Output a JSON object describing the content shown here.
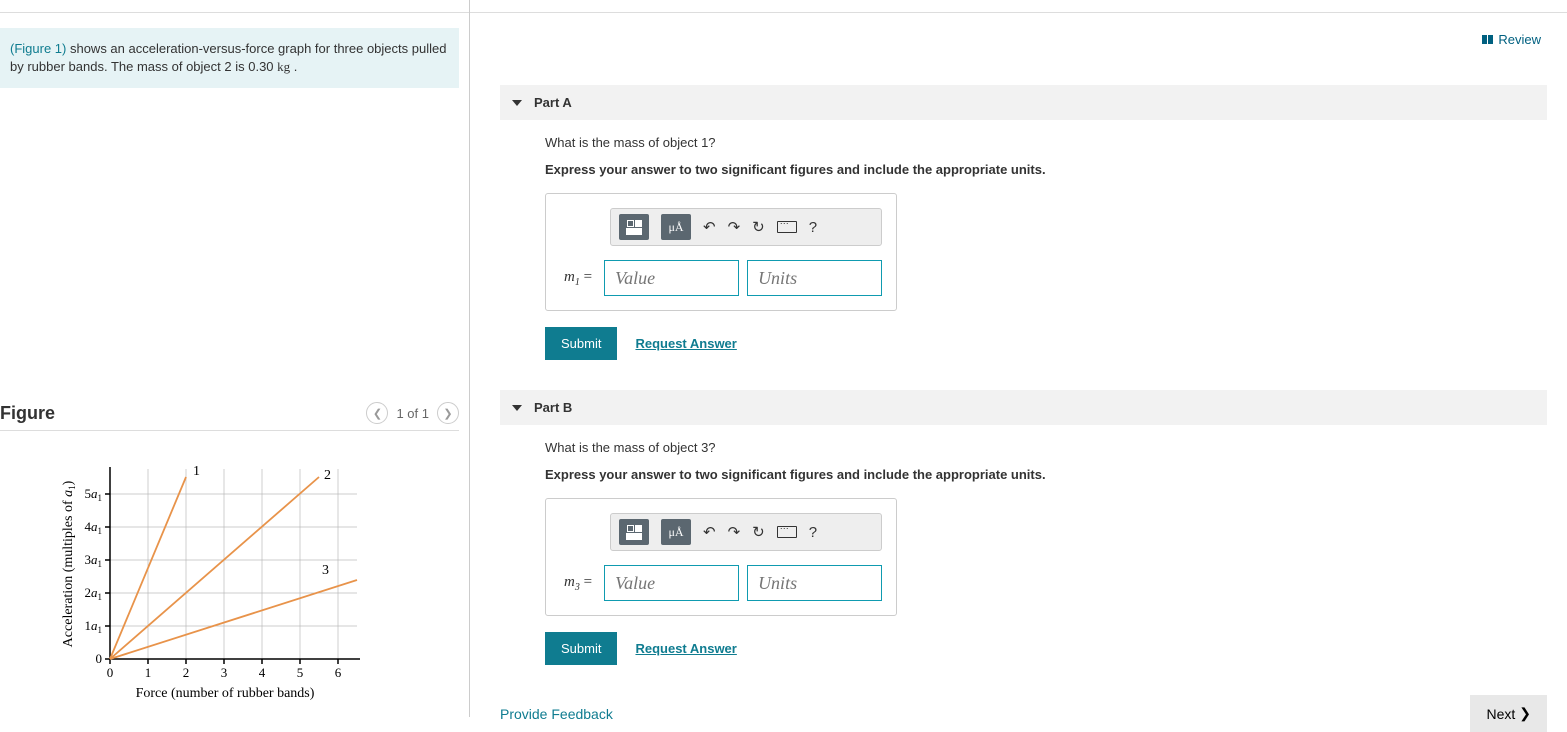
{
  "problem": {
    "figure_ref": "(Figure 1)",
    "text": " shows an acceleration-versus-force graph for three objects pulled by rubber bands. The mass of object 2 is 0.30 ",
    "unit": "kg",
    "tail": " ."
  },
  "review": "Review",
  "figure": {
    "title": "Figure",
    "pager": "1 of 1"
  },
  "partA": {
    "label": "Part A",
    "question": "What is the mass of object 1?",
    "instruction": "Express your answer to two significant figures and include the appropriate units.",
    "var": "m",
    "sub": "1",
    "eq": " = ",
    "value_placeholder": "Value",
    "units_placeholder": "Units",
    "submit": "Submit",
    "request": "Request Answer",
    "mua": "μÅ",
    "help": "?"
  },
  "partB": {
    "label": "Part B",
    "question": "What is the mass of object 3?",
    "instruction": "Express your answer to two significant figures and include the appropriate units.",
    "var": "m",
    "sub": "3",
    "eq": " = ",
    "value_placeholder": "Value",
    "units_placeholder": "Units",
    "submit": "Submit",
    "request": "Request Answer",
    "mua": "μÅ",
    "help": "?"
  },
  "feedback": "Provide Feedback",
  "next": "Next",
  "chart_data": {
    "type": "line",
    "xlabel": "Force (number of rubber bands)",
    "ylabel": "Acceleration (multiples of a₁)",
    "x_ticks": [
      0,
      1,
      2,
      3,
      4,
      5,
      6
    ],
    "y_ticks": [
      "0",
      "1a₁",
      "2a₁",
      "3a₁",
      "4a₁",
      "5a₁"
    ],
    "xlim": [
      0,
      6.5
    ],
    "ylim": [
      0,
      5.5
    ],
    "series": [
      {
        "name": "1",
        "points": [
          [
            0,
            0
          ],
          [
            2,
            5.5
          ]
        ],
        "label_pos": [
          2,
          5.5
        ]
      },
      {
        "name": "2",
        "points": [
          [
            0,
            0
          ],
          [
            5.5,
            5.5
          ]
        ],
        "label_pos": [
          5.5,
          5.5
        ]
      },
      {
        "name": "3",
        "points": [
          [
            0,
            0
          ],
          [
            6.5,
            2.4
          ]
        ],
        "label_pos": [
          5.7,
          2.35
        ]
      }
    ]
  }
}
